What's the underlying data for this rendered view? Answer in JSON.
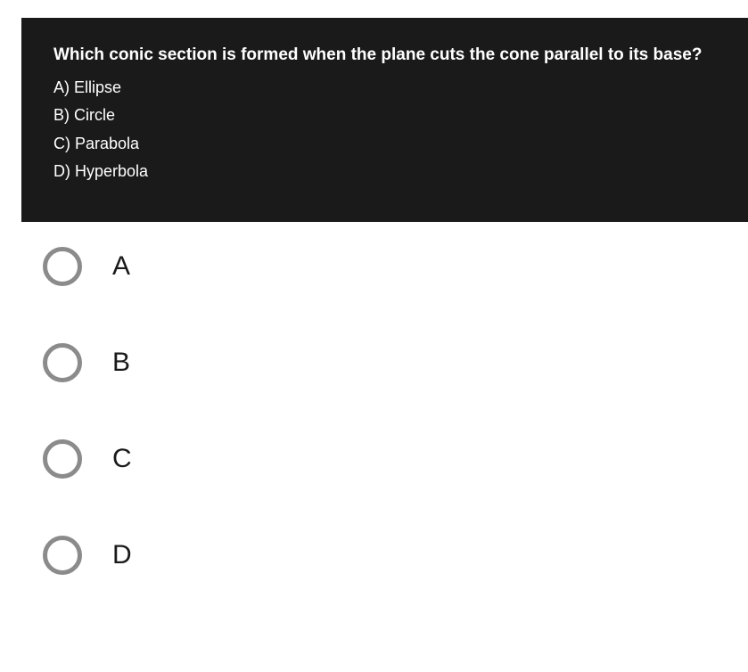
{
  "question": {
    "prompt": "Which conic section is formed when the plane cuts the cone parallel to its base?",
    "choices": {
      "a": "A) Ellipse",
      "b": "B) Circle",
      "c": "C) Parabola",
      "d": "D) Hyperbola"
    }
  },
  "answers": {
    "a": "A",
    "b": "B",
    "c": "C",
    "d": "D"
  }
}
